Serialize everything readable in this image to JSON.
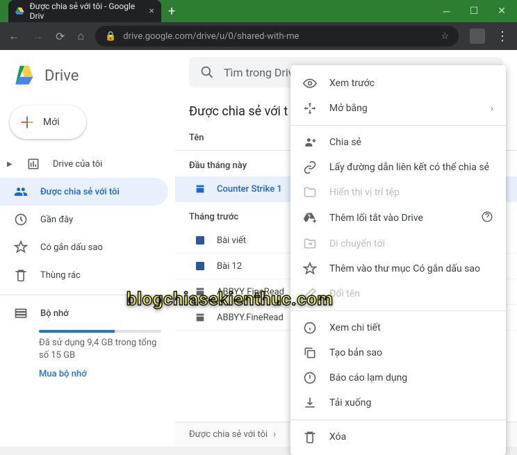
{
  "browser": {
    "tab_title": "Được chia sẻ với tôi - Google Driv",
    "url": "drive.google.com/drive/u/0/shared-with-me"
  },
  "brand": "Drive",
  "new_button": "Mới",
  "sidebar": {
    "items": [
      {
        "label": "Drive của tôi"
      },
      {
        "label": "Được chia sẻ với tôi"
      },
      {
        "label": "Gần đây"
      },
      {
        "label": "Có gắn dấu sao"
      },
      {
        "label": "Thùng rác"
      }
    ],
    "storage_label": "Bộ nhớ",
    "storage_detail": "Đã sử dụng 9,4 GB trong tổng số 15 GB",
    "buy_link": "Mua bộ nhớ"
  },
  "search": {
    "placeholder": "Tìm trong Driv"
  },
  "page_title": "Được chia sẻ với t",
  "col_name": "Tên",
  "section_this_month": "Đầu tháng này",
  "section_last_month": "Tháng trước",
  "files": {
    "selected": "Counter Strike 1",
    "row2": "Bài viết",
    "row3": "Bài 12",
    "row4": "ABBYY FineRead",
    "row5": "ABBYY.FineRead"
  },
  "breadcrumb": "Được chia sẻ với tôi",
  "ctx": {
    "preview": "Xem trước",
    "openwith": "Mở bằng",
    "share": "Chia sẻ",
    "getlink": "Lấy đường dẫn liên kết có thể chia sẻ",
    "showloc": "Hiển thị vị trí tệp",
    "addshortcut": "Thêm lối tắt vào Drive",
    "moveto": "Di chuyển tới",
    "addstar": "Thêm vào thư mục Có gắn dấu sao",
    "rename": "Đổi tên",
    "details": "Xem chi tiết",
    "copy": "Tạo bản sao",
    "report": "Báo cáo lạm dụng",
    "download": "Tải xuống",
    "delete": "Xóa"
  },
  "watermark": "blogchiasekienthuc.com"
}
